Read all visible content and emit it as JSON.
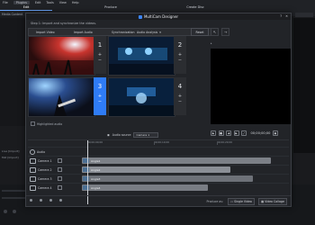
{
  "host": {
    "menu": [
      "File",
      "Plugins",
      "Edit",
      "Tools",
      "View",
      "Help"
    ],
    "tabs": [
      "Edit",
      "Produce",
      "Create Disc"
    ],
    "media_label": "Media Content",
    "left_labels": [
      "Live [Import]",
      "Mid [Import]"
    ]
  },
  "dialog": {
    "title": "MultiCam Designer",
    "subtitle": "Step 1: Import and synchronize the videos.",
    "buttons": {
      "import_video": "Import Video",
      "import_audio": "Import Audio",
      "synchronization": "Synchronization",
      "audio_analysis": "Audio Analysis",
      "reset": "Reset"
    },
    "slots": [
      {
        "number": "1",
        "active": false
      },
      {
        "number": "2",
        "active": false
      },
      {
        "number": "3",
        "active": true
      },
      {
        "number": "4",
        "active": false
      }
    ],
    "highlighted_audio_label": "Highlighted audio",
    "audio_source_label": "Audio source",
    "audio_source_value": "Camera 1",
    "timecode": "00;00;00;00",
    "ruler_labels": [
      "00;00;00;00",
      "00;00;10;00",
      "00;00;20;00",
      "00;00;30;00"
    ],
    "tracks": [
      {
        "name": "Audio",
        "type": "audio"
      },
      {
        "name": "Camera 1",
        "type": "camera",
        "clip": "Angle1",
        "color": "#7c8087"
      },
      {
        "name": "Camera 2",
        "type": "camera",
        "clip": "Angle2",
        "color": "#8b8f96"
      },
      {
        "name": "Camera 3",
        "type": "camera",
        "clip": "Angle3",
        "color": "#6d7178"
      },
      {
        "name": "Camera 4",
        "type": "camera",
        "clip": "Angle4",
        "color": "#797d84"
      }
    ],
    "footer": {
      "produce_as": "Produce as:",
      "single_video": "Single Video",
      "video_collage": "Video Collage"
    }
  },
  "colors": {
    "accent": "#2f7cf6",
    "bg": "#1a1b1e"
  }
}
